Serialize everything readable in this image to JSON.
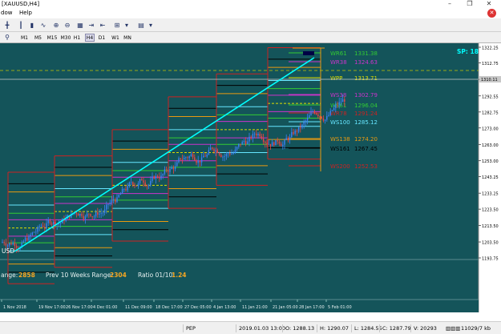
{
  "window": {
    "title": "[XAUUSD,H4]"
  },
  "menu": {
    "items": [
      "dow",
      "Help"
    ]
  },
  "timeframes": [
    "M1",
    "M5",
    "M15",
    "M30",
    "H1",
    "H4",
    "D1",
    "W1",
    "MN"
  ],
  "active_timeframe": "H4",
  "chart": {
    "symbol_label": "USD",
    "spread_label": "SP: 18",
    "current_price": "1310.11",
    "price_ticks": [
      "1322.25",
      "1312.75",
      "1302.65",
      "1292.55",
      "1282.75",
      "1273.00",
      "1263.00",
      "1253.00",
      "1243.25",
      "1233.25",
      "1223.50",
      "1213.50",
      "1203.50",
      "1193.75"
    ],
    "time_ticks": [
      "1 Nov 2018",
      "19 Nov 17:00",
      "26 Nov 17:00",
      "4 Dec 01:00",
      "11 Dec 09:00",
      "18 Dec 17:00",
      "27 Dec 05:00",
      "4 Jan 13:00",
      "11 Jan 21:00",
      "21 Jan 05:00",
      "28 Jan 17:00",
      "5 Feb 01:00"
    ],
    "levels": [
      {
        "label": "WR61",
        "value": "1331.38",
        "color": "#33cc33"
      },
      {
        "label": "WR38",
        "value": "1324.63",
        "color": "#cc33cc"
      },
      {
        "label": "WPP",
        "value": "1313.71",
        "color": "#dddd00"
      },
      {
        "label": "WS38",
        "value": "1302.79",
        "color": "#cc33cc"
      },
      {
        "label": "WS61",
        "value": "1296.04",
        "color": "#33cc33"
      },
      {
        "label": "WR78",
        "value": "1291.24",
        "color": "#cc2222"
      },
      {
        "label": "WS100",
        "value": "1285.12",
        "color": "#66e6ff"
      },
      {
        "label": "WS138",
        "value": "1274.20",
        "color": "#e89a10"
      },
      {
        "label": "WS161",
        "value": "1267.45",
        "color": "#000000"
      },
      {
        "label": "WS200",
        "value": "1252.53",
        "color": "#cc2222"
      }
    ],
    "stats": {
      "range_label": "ange:",
      "range_value": "2858",
      "prev_label": "Prev 10 Weeks Range:",
      "prev_value": "2304",
      "ratio_label": "Ratio 01/10:",
      "ratio_value": "1.24"
    },
    "colors": {
      "background": "#14545a",
      "trendline": "#00ffff",
      "up_candle": "#3b82f6",
      "down_candle": "#ef4444"
    }
  },
  "status": {
    "profile": "PEP",
    "datetime": "2019.01.03 13:00",
    "open": "O: 1288.13",
    "high": "H: 1290.07",
    "low": "L: 1284.55",
    "close": "C: 1287.79",
    "volume": "V: 20293",
    "traffic": "11029/7 kb"
  }
}
